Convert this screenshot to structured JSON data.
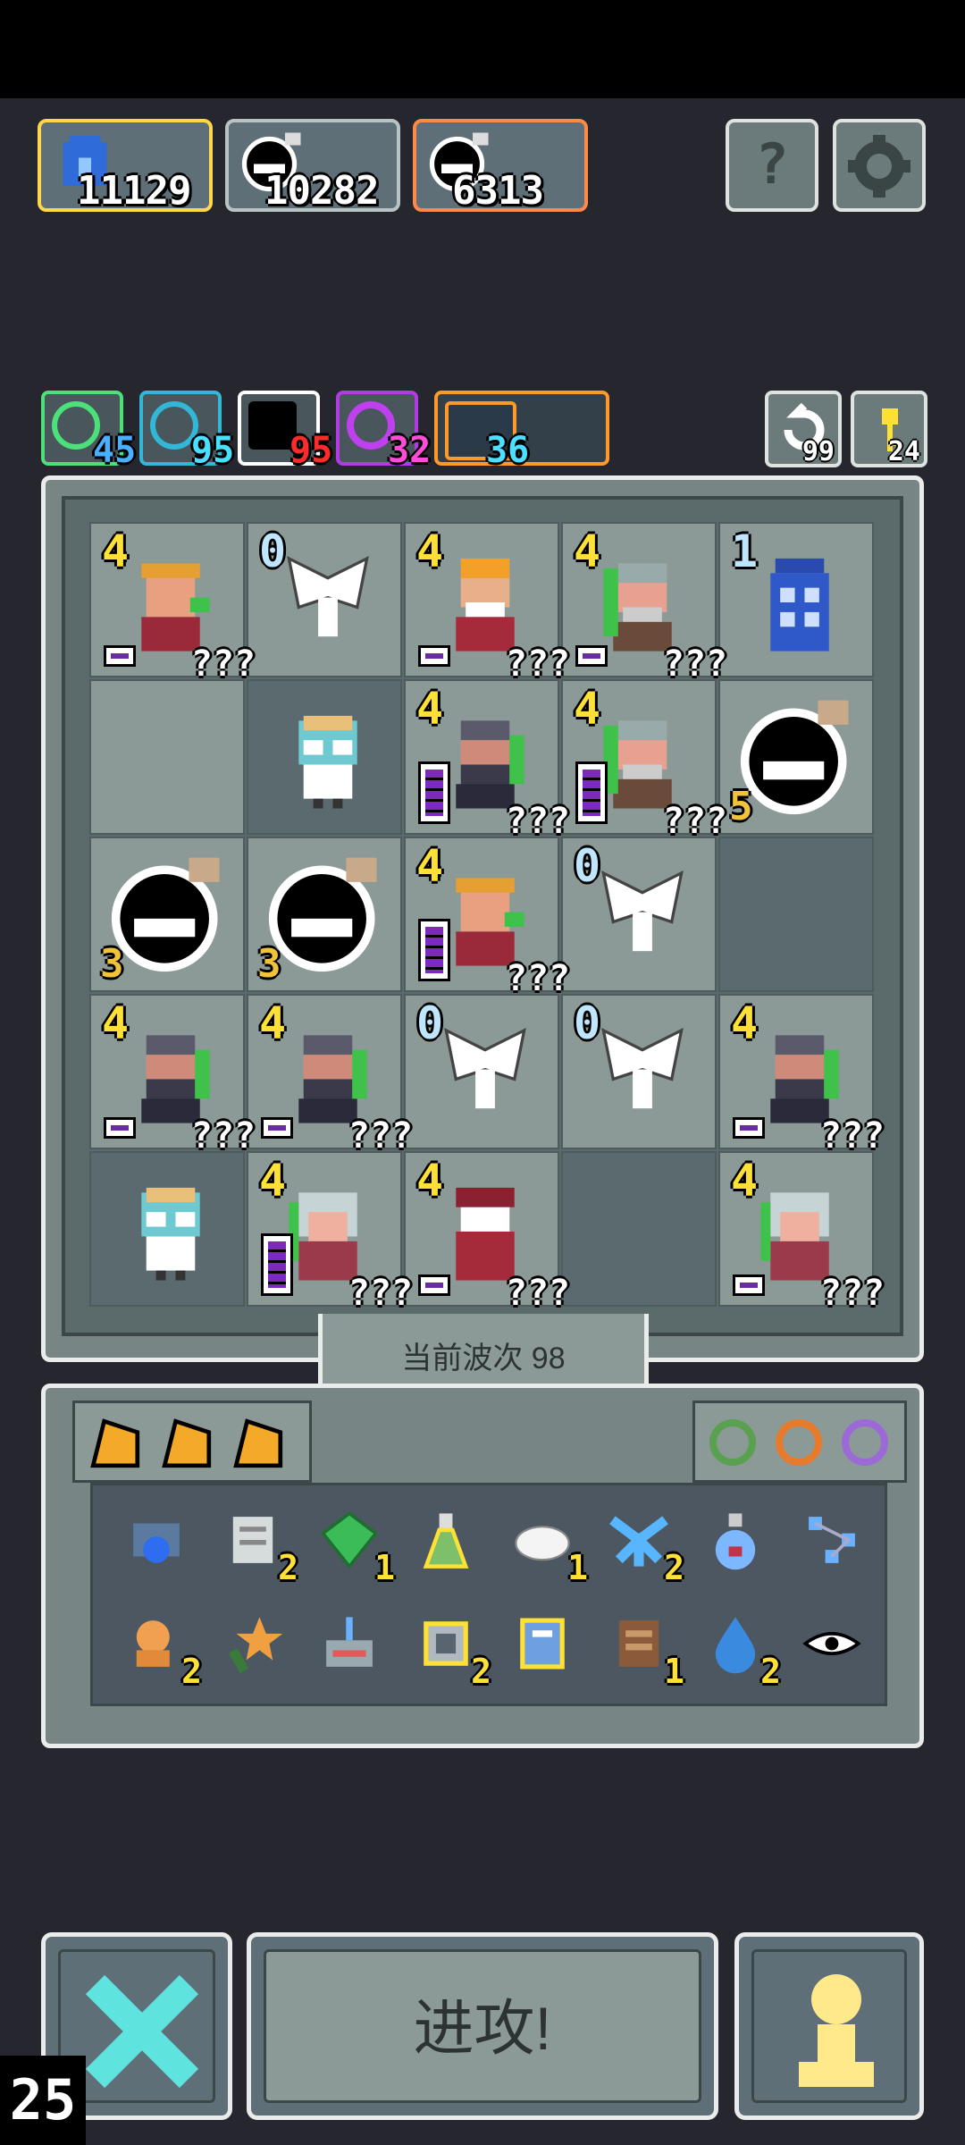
{
  "top_stats": [
    {
      "name": "blue-creature",
      "value": "11129",
      "border": "#ffd84a"
    },
    {
      "name": "bomb-black",
      "value": "10282",
      "border": "#b8c4c4"
    },
    {
      "name": "bomb-black-orange",
      "value": "6313",
      "border": "#ff8a48"
    }
  ],
  "top_buttons": {
    "help_label": "?",
    "settings_icon": "gear-icon"
  },
  "resources": [
    {
      "value": "45",
      "color": "#4be07a",
      "text_color": "#48b0ff"
    },
    {
      "value": "95",
      "color": "#32b7d7",
      "text_color": "#49e0ff"
    },
    {
      "value": "95",
      "color": "#ffffff",
      "text_color": "#ff2a2a"
    },
    {
      "value": "32",
      "color": "#b33be6",
      "text_color": "#ff4bd8"
    },
    {
      "value": "36",
      "color": "#ff9a2a",
      "text_color": "#4be0ff"
    }
  ],
  "side_counters": {
    "refresh": "99",
    "key": "24"
  },
  "board": {
    "rows": [
      [
        {
          "lvl": "4",
          "unit": "bandit",
          "qq": "???",
          "bar": "short"
        },
        {
          "lvl": "0",
          "unit": "bat"
        },
        {
          "lvl": "4",
          "unit": "fire-king",
          "qq": "???",
          "bar": "short"
        },
        {
          "lvl": "4",
          "unit": "old-man",
          "qq": "???",
          "bar": "short"
        },
        {
          "lvl": "1",
          "unit": "blue-box"
        }
      ],
      [
        {
          "dark": false
        },
        {
          "unit": "zombie-scientist",
          "dark": true
        },
        {
          "lvl": "4",
          "unit": "dwarf",
          "qq": "???",
          "bar": "tall"
        },
        {
          "lvl": "4",
          "unit": "old-man",
          "qq": "???",
          "bar": "tall"
        },
        {
          "unit": "bomb",
          "count": "5"
        }
      ],
      [
        {
          "unit": "bomb",
          "count": "3"
        },
        {
          "unit": "bomb",
          "count": "3"
        },
        {
          "lvl": "4",
          "unit": "bandit",
          "qq": "???",
          "bar": "tall"
        },
        {
          "lvl": "0",
          "unit": "bat"
        },
        {
          "dark": true
        }
      ],
      [
        {
          "lvl": "4",
          "unit": "dwarf",
          "qq": "???",
          "bar": "short"
        },
        {
          "lvl": "4",
          "unit": "dwarf",
          "qq": "???",
          "bar": "short"
        },
        {
          "lvl": "0",
          "unit": "bat"
        },
        {
          "lvl": "0",
          "unit": "bat"
        },
        {
          "lvl": "4",
          "unit": "dwarf",
          "qq": "???",
          "bar": "short"
        }
      ],
      [
        {
          "unit": "zombie-scientist",
          "dark": true
        },
        {
          "lvl": "4",
          "unit": "girl",
          "qq": "???",
          "bar": "tall"
        },
        {
          "lvl": "4",
          "unit": "red-mage",
          "qq": "???",
          "bar": "short"
        },
        {
          "dark": true
        },
        {
          "lvl": "4",
          "unit": "girl",
          "qq": "???",
          "bar": "short"
        }
      ]
    ]
  },
  "wave_label": "当前波次 98",
  "inventory": {
    "tabs": [
      "cheese",
      "cheese",
      "cheese"
    ],
    "rings": [
      "green-ring",
      "orange-ring",
      "purple-ring"
    ],
    "row1": [
      {
        "icon": "blue-crystal-bag",
        "count": ""
      },
      {
        "icon": "scroll",
        "count": "2"
      },
      {
        "icon": "green-gem",
        "count": "1"
      },
      {
        "icon": "potion-flask",
        "count": ""
      },
      {
        "icon": "cloud",
        "count": "1"
      },
      {
        "icon": "ice-crystal",
        "count": "2"
      },
      {
        "icon": "blue-potion",
        "count": ""
      },
      {
        "icon": "network",
        "count": ""
      }
    ],
    "row2": [
      {
        "icon": "orange-bag",
        "count": "2"
      },
      {
        "icon": "star-wand",
        "count": ""
      },
      {
        "icon": "radio-box",
        "count": ""
      },
      {
        "icon": "chip",
        "count": "2"
      },
      {
        "icon": "blue-book",
        "count": ""
      },
      {
        "icon": "brown-book",
        "count": "1"
      },
      {
        "icon": "water-drop",
        "count": "2"
      },
      {
        "icon": "eye-scroll",
        "count": ""
      }
    ]
  },
  "bottom": {
    "attack_label": "进攻!",
    "fps": "25"
  },
  "colors": {
    "accent": "#ffe136",
    "panel": "#778584",
    "bg": "#26272e"
  }
}
